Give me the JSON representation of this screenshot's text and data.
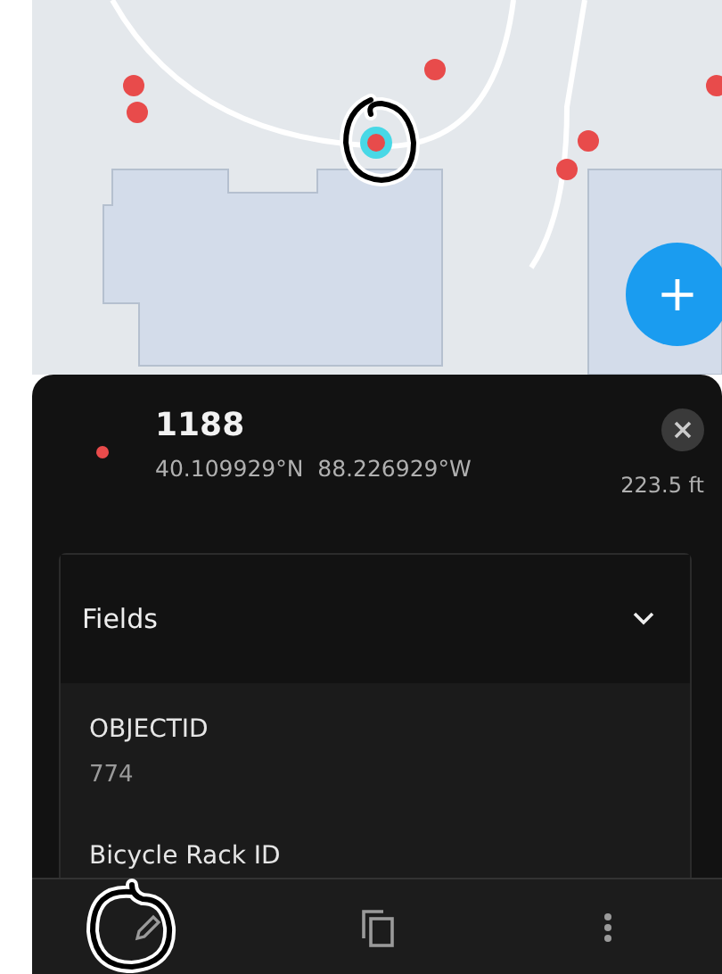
{
  "add_button": {
    "label": "+"
  },
  "feature": {
    "title": "1188",
    "coordinates": "40.109929°N  88.226929°W",
    "distance": "223.5 ft",
    "color": "#e84b4b"
  },
  "fields_section": {
    "title": "Fields",
    "expanded": true,
    "fields": [
      {
        "label": "OBJECTID",
        "value": "774"
      },
      {
        "label": "Bicycle Rack ID"
      }
    ]
  },
  "toolbar": [
    {
      "kind": "edit"
    },
    {
      "kind": "copy"
    },
    {
      "kind": "more"
    }
  ]
}
